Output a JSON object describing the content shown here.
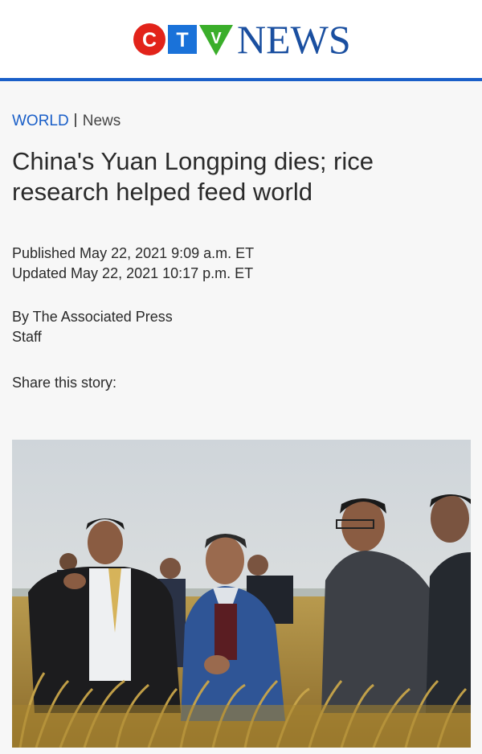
{
  "brand": {
    "logo_letters": [
      "C",
      "T",
      "V"
    ],
    "logo_word": "NEWS",
    "colors": {
      "red": "#e2231a",
      "blue": "#1a72d9",
      "green": "#3aae2a",
      "navy": "#1a4fa0",
      "rule": "#1a5fc8"
    }
  },
  "breadcrumb": {
    "section": "WORLD",
    "subsection": "News"
  },
  "article": {
    "headline": "China's Yuan Longping dies; rice research helped feed world",
    "published": "Published May 22, 2021 9:09 a.m. ET",
    "updated": "Updated May 22, 2021 10:17 p.m. ET",
    "byline": "By The Associated Press",
    "byline_role": "Staff",
    "share_label": "Share this story:"
  },
  "photo": {
    "subject": "men in rice field"
  }
}
